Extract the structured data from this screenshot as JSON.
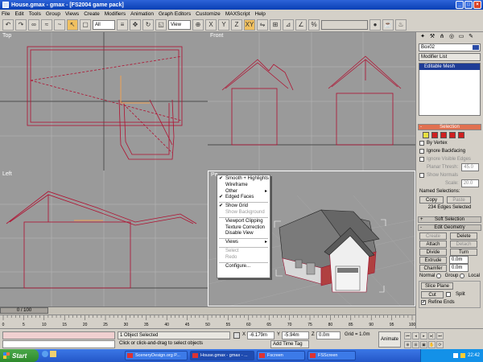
{
  "window": {
    "title": "House.gmax - gmax - [FS2004 game pack]"
  },
  "menubar": [
    "File",
    "Edit",
    "Tools",
    "Group",
    "Views",
    "Create",
    "Modifiers",
    "Animation",
    "Graph Editors",
    "Customize",
    "MAXScript",
    "Help"
  ],
  "toolbar": {
    "selection_filter": "All",
    "ref_coord": "View"
  },
  "viewports": {
    "top": "Top",
    "front": "Front",
    "left": "Left",
    "perspective": "Pe"
  },
  "context_menu": {
    "items": [
      "Smooth + Highlights",
      "Wireframe",
      "Other",
      "Edged Faces",
      "Show Grid",
      "Show Background",
      "Viewport Clipping",
      "Texture Correction",
      "Disable View",
      "Views",
      "Select",
      "Redo",
      "Configure..."
    ],
    "checked": [
      "Smooth + Highlights",
      "Edged Faces",
      "Show Grid"
    ],
    "disabled": [
      "Show Background",
      "Select",
      "Redo"
    ]
  },
  "command_panel": {
    "object_name": "Box02",
    "modifier_list": "Modifier List",
    "stack_selected": "Editable Mesh",
    "selection_rollout": "Selection",
    "by_vertex": "By Vertex",
    "ignore_backfacing": "Ignore Backfacing",
    "ignore_visible": "Ignore Visible Edges",
    "planar_thresh": "Planar Thresh:",
    "planar_value": "45.0",
    "show_normals": "Show Normals",
    "scale_label": "Scale:",
    "scale_value": "20.0",
    "named_selections": "Named Selections:",
    "copy": "Copy",
    "paste": "Paste",
    "edges_selected": "234 Edges Selected",
    "soft_selection": "Soft Selection",
    "edit_geometry": "Edit Geometry",
    "create": "Create",
    "delete": "Delete",
    "attach": "Attach",
    "detach": "Detach",
    "divide": "Divide",
    "turn": "Turn",
    "extrude": "Extrude",
    "extrude_value": "0.0m",
    "chamfer": "Chamfer",
    "chamfer_value": "0.0m",
    "normal": "Normal",
    "group": "Group",
    "local": "Local",
    "slice_plane": "Slice Plane",
    "cut": "Cut",
    "split": "Split",
    "refine_ends": "Refine Ends"
  },
  "timeline": {
    "slider": "0 / 100",
    "ticks": [
      "0",
      "5",
      "10",
      "15",
      "20",
      "25",
      "30",
      "35",
      "40",
      "45",
      "50",
      "55",
      "60",
      "65",
      "70",
      "75",
      "80",
      "85",
      "90",
      "95",
      "100"
    ]
  },
  "status": {
    "selected": "1 Object Selected",
    "prompt": "Click or click-and-drag to select objects",
    "x": "-6.179m",
    "y": "-5.94m",
    "z": "0.0m",
    "grid": "Grid = 1.0m",
    "add_time_tag": "Add Time Tag",
    "animate": "Animate"
  },
  "taskbar": {
    "start": "Start",
    "tasks": [
      "SceneryDesign.org P...",
      "House.gmax - gmax - ...",
      "Fscreen",
      "FSScreen"
    ],
    "clock": "22:42"
  }
}
